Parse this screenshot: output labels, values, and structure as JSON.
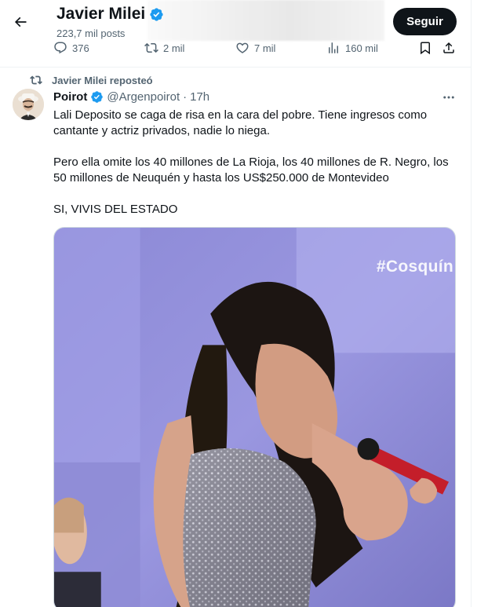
{
  "header": {
    "profile_name": "Javier Milei",
    "post_count": "223,7 mil posts",
    "follow_label": "Seguir"
  },
  "actions": {
    "replies": "376",
    "reposts": "2 mil",
    "likes": "7 mil",
    "views": "160 mil"
  },
  "tweet": {
    "repost_label": "Javier Milei reposteó",
    "author_name": "Poirot",
    "author_handle": "@Argenpoirot",
    "separator": "·",
    "time": "17h",
    "paragraphs": [
      "Lali Deposito se caga de risa en la cara del pobre. Tiene ingresos como cantante y actriz privados, nadie lo niega.",
      "Pero ella omite los 40 millones de La Rioja, los 40 millones de R. Negro, los 50 millones de Neuquén y hasta los US$250.000 de Montevideo",
      "SI, VIVIS DEL ESTADO"
    ],
    "media_watermark": "#Cosquín"
  },
  "colors": {
    "accent_blue": "#1d9bf0",
    "text_primary": "#0f1419",
    "text_secondary": "#536471",
    "follow_bg": "#0f1419"
  },
  "icons": [
    "back-arrow-icon",
    "verified-badge-icon",
    "reply-icon",
    "repost-icon",
    "like-icon",
    "views-icon",
    "bookmark-icon",
    "share-icon",
    "more-icon"
  ]
}
